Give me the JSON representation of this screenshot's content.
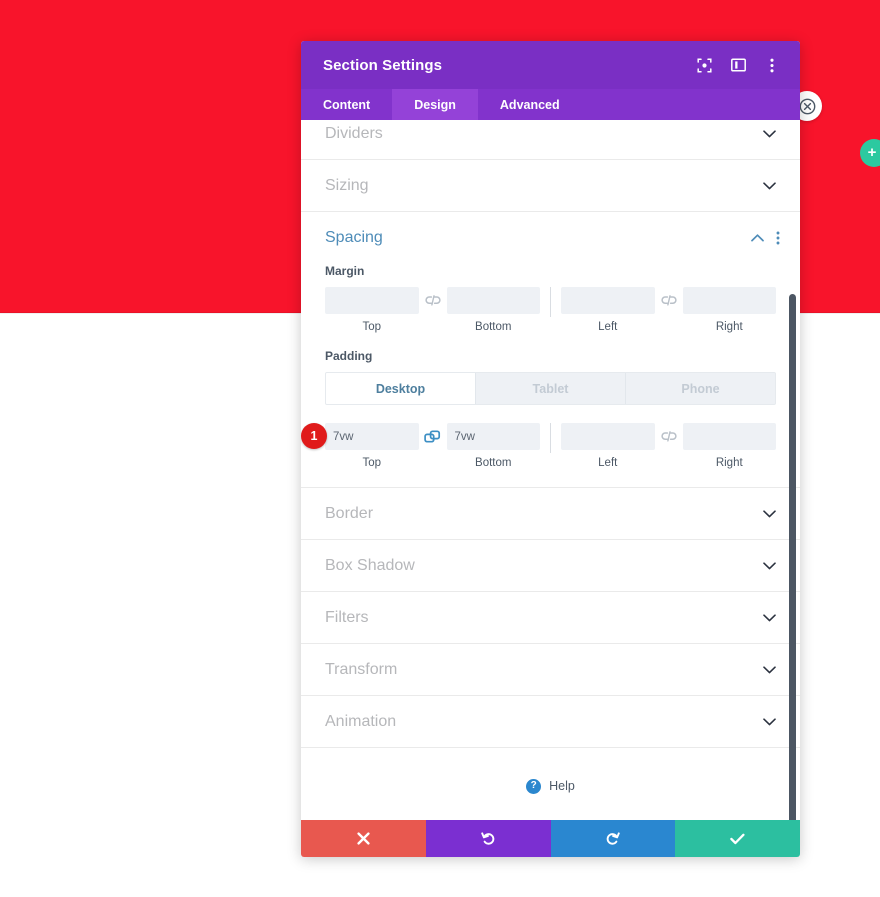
{
  "page": {
    "hero_color": "#f8142b",
    "close_icon": "close-circle-icon",
    "add_icon": "plus-icon",
    "add_label": "+"
  },
  "modal": {
    "title": "Section Settings",
    "header_icons": [
      {
        "name": "focus-target-icon",
        "label": "Focus"
      },
      {
        "name": "layout-panel-icon",
        "label": "Layout"
      },
      {
        "name": "more-vertical-icon",
        "label": "More options"
      }
    ],
    "tabs": [
      {
        "label": "Content",
        "active": false
      },
      {
        "label": "Design",
        "active": true
      },
      {
        "label": "Advanced",
        "active": false
      }
    ],
    "accent_color": "#7a2fc4",
    "tab_active_color": "#9442d8"
  },
  "sections": {
    "above": [
      {
        "label": "Dividers",
        "state": "collapsed"
      },
      {
        "label": "Sizing",
        "state": "collapsed"
      }
    ],
    "below": [
      {
        "label": "Border",
        "state": "collapsed"
      },
      {
        "label": "Box Shadow",
        "state": "collapsed"
      },
      {
        "label": "Filters",
        "state": "collapsed"
      },
      {
        "label": "Transform",
        "state": "collapsed"
      },
      {
        "label": "Animation",
        "state": "collapsed"
      }
    ]
  },
  "spacing": {
    "title": "Spacing",
    "title_color": "#4e8cb8",
    "collapse_icon": "chevron-up-icon",
    "options_icon": "more-vertical-icon",
    "margin": {
      "label": "Margin",
      "linked_vertical": false,
      "linked_horizontal": false,
      "fields": [
        {
          "caption": "Top",
          "value": "",
          "placeholder": ""
        },
        {
          "caption": "Bottom",
          "value": "",
          "placeholder": ""
        },
        {
          "caption": "Left",
          "value": "",
          "placeholder": ""
        },
        {
          "caption": "Right",
          "value": "",
          "placeholder": ""
        }
      ]
    },
    "padding": {
      "label": "Padding",
      "devices": [
        {
          "label": "Desktop",
          "active": true
        },
        {
          "label": "Tablet",
          "active": false
        },
        {
          "label": "Phone",
          "active": false
        }
      ],
      "linked_vertical": true,
      "linked_horizontal": false,
      "step_badge": "1",
      "step_badge_color": "#e01b1b",
      "fields": [
        {
          "caption": "Top",
          "value": "7vw",
          "placeholder": ""
        },
        {
          "caption": "Bottom",
          "value": "7vw",
          "placeholder": ""
        },
        {
          "caption": "Left",
          "value": "",
          "placeholder": ""
        },
        {
          "caption": "Right",
          "value": "",
          "placeholder": ""
        }
      ]
    }
  },
  "footer": {
    "help_label": "Help",
    "help_icon": "question-circle-icon",
    "actions": [
      {
        "name": "cancel",
        "icon": "close-icon",
        "color": "#e8584f"
      },
      {
        "name": "undo",
        "icon": "undo-icon",
        "color": "#7b2fd1"
      },
      {
        "name": "redo",
        "icon": "redo-icon",
        "color": "#2a87d0"
      },
      {
        "name": "save",
        "icon": "check-icon",
        "color": "#2cbfa0"
      }
    ]
  }
}
